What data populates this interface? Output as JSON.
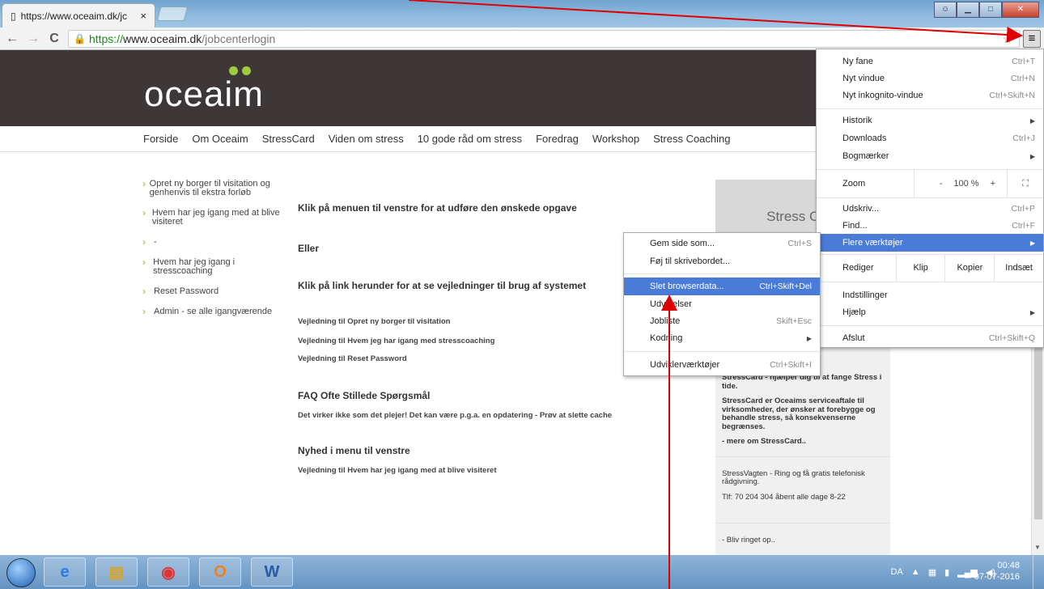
{
  "browser": {
    "tab_title": "https://www.oceaim.dk/jc",
    "tab_close": "×",
    "url": {
      "https": "https://",
      "host": "www.oceaim.dk",
      "path": "/jobcenterlogin"
    }
  },
  "site": {
    "logo": "oceaim",
    "nav": [
      "Forside",
      "Om Oceaim",
      "StressCard",
      "Viden om stress",
      "10 gode råd om stress",
      "Foredrag",
      "Workshop",
      "Stress Coaching"
    ],
    "sidebar": [
      "Opret ny borger til visitation og genhenvis til ekstra forløb",
      "Hvem har jeg igang med at blive visiteret",
      "-",
      "Hvem har jeg igang i stresscoaching",
      "Reset Password",
      "Admin - se alle igangværende"
    ],
    "main": {
      "h1": "Klik på menuen til venstre for at udføre den ønskede opgave",
      "eller": "Eller",
      "h2": "Klik på link herunder for at se vejledninger til brug af systemet",
      "links": [
        "Vejledning til Opret ny borger til visitation",
        "Vejledning til Hvem jeg har igang med stresscoaching",
        "Vejledning til Reset Password"
      ],
      "faq_title": "FAQ Ofte Stillede Spørgsmål",
      "faq_text": "Det virker ikke som det plejer! Det kan være p.g.a. en opdatering - Prøv at slette cache",
      "news_title": "Nyhed i menu til venstre",
      "news_text": "Vejledning til Hvem har jeg igang med at blive visiteret"
    },
    "stresscard": {
      "title": "Stress Card",
      "p1": "StressCard - hjælper dig til at fange Stress i tide.",
      "p2": "StressCard er Oceaims serviceaftale til virksomheder, der ønsker at forebygge og behandle stress, så konsekvenserne begrænses.",
      "more": "- mere om StressCard..",
      "p3": "StressVagten - Ring og få gratis telefonisk rådgivning.",
      "phone": "Tlf: 70 204 304 åbent alle dage 8-22",
      "call": "- Bliv ringet op.."
    }
  },
  "chrome_menu": {
    "new_tab": "Ny fane",
    "new_tab_sc": "Ctrl+T",
    "new_window": "Nyt vindue",
    "new_window_sc": "Ctrl+N",
    "incognito": "Nyt inkognito-vindue",
    "incognito_sc": "Ctrl+Skift+N",
    "history": "Historik",
    "downloads": "Downloads",
    "downloads_sc": "Ctrl+J",
    "bookmarks": "Bogmærker",
    "zoom": "Zoom",
    "zoom_minus": "-",
    "zoom_value": "100 %",
    "zoom_plus": "+",
    "print": "Udskriv...",
    "print_sc": "Ctrl+P",
    "find": "Find...",
    "find_sc": "Ctrl+F",
    "more_tools": "Flere værktøjer",
    "edit": "Rediger",
    "cut": "Klip",
    "copy": "Kopier",
    "paste": "Indsæt",
    "settings": "Indstillinger",
    "help": "Hjælp",
    "exit": "Afslut",
    "exit_sc": "Ctrl+Skift+Q"
  },
  "sub_menu": {
    "save_page": "Gem side som...",
    "save_page_sc": "Ctrl+S",
    "add_desktop": "Føj til skrivebordet...",
    "clear_data": "Slet browserdata...",
    "clear_data_sc": "Ctrl+Skift+Del",
    "extensions": "Udvidelser",
    "task_manager": "Jobliste",
    "task_manager_sc": "Skift+Esc",
    "encoding": "Kodning",
    "devtools": "Udviklerværktøjer",
    "devtools_sc": "Ctrl+Skift+I"
  },
  "taskbar": {
    "lang": "DA",
    "time": "00:48",
    "date": "07-07-2016"
  },
  "colors": {
    "accent": "#4a7bd6",
    "logo_dots": "#9dcb3b",
    "annotation": "#e00000"
  }
}
